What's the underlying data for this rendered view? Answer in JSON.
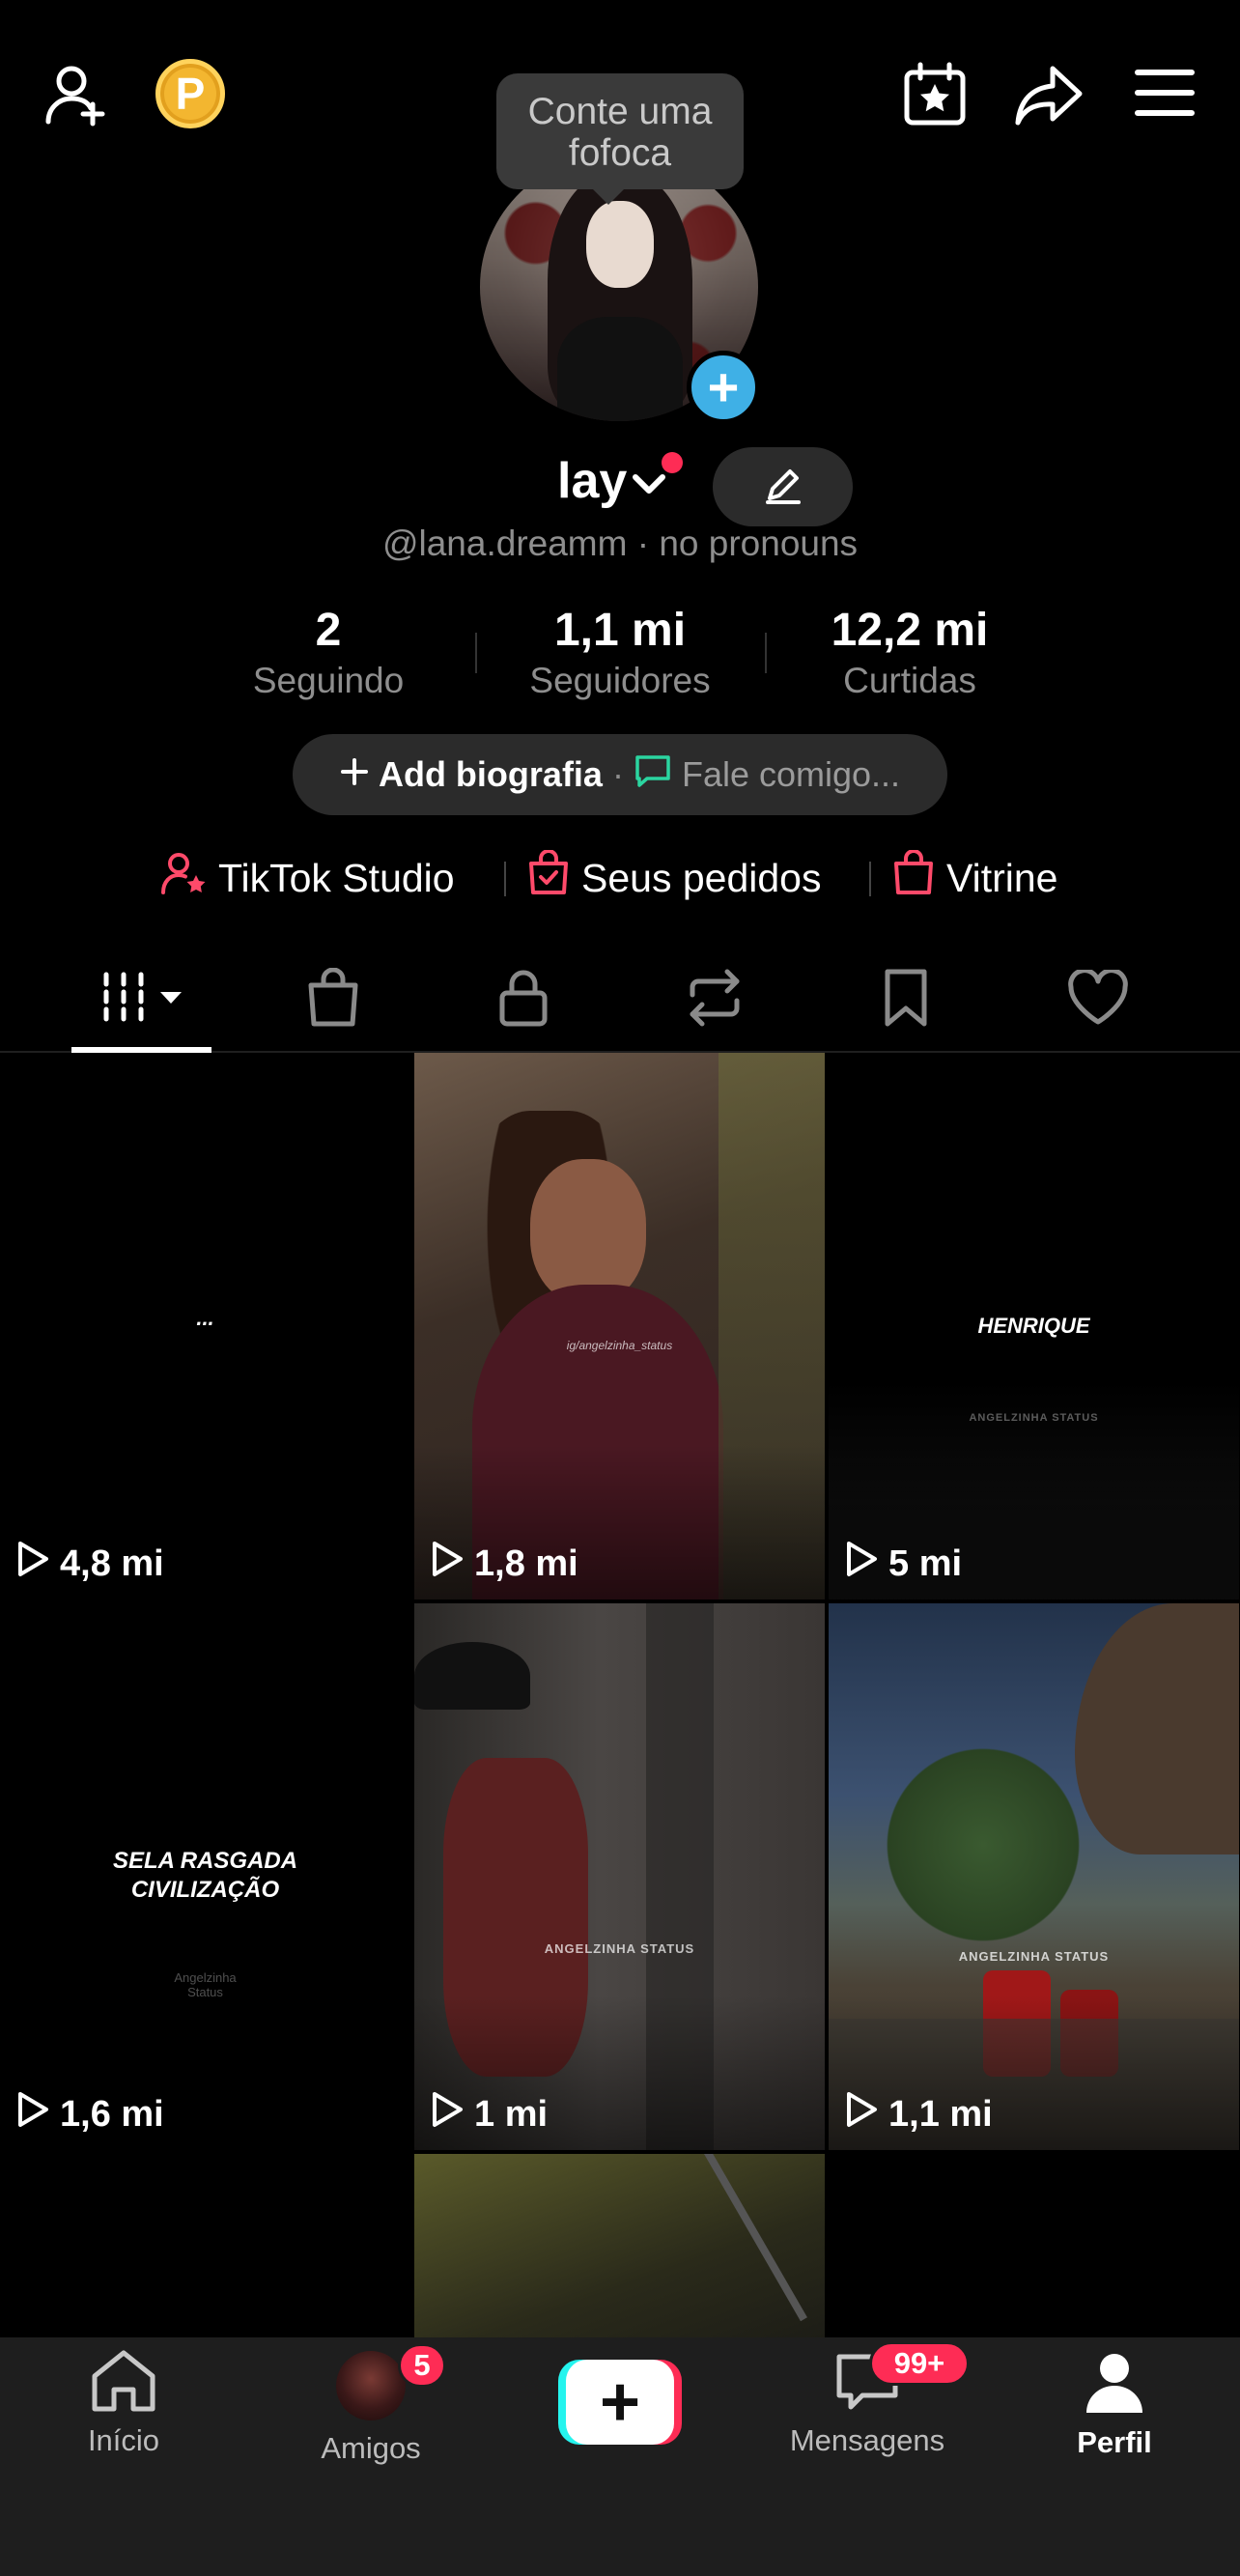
{
  "tooltip": "Conte uma fofoca",
  "profile": {
    "display_name": "lay",
    "handle": "@lana.dreamm · no pronouns"
  },
  "stats": [
    {
      "value": "2",
      "label": "Seguindo"
    },
    {
      "value": "1,1 mi",
      "label": "Seguidores"
    },
    {
      "value": "12,2 mi",
      "label": "Curtidas"
    }
  ],
  "bio": {
    "add_label": "Add biografia",
    "separator": "·",
    "chat_label": "Fale comigo..."
  },
  "links": [
    {
      "label": "TikTok Studio",
      "icon": "creator-icon"
    },
    {
      "label": "Seus pedidos",
      "icon": "orders-bag-icon"
    },
    {
      "label": "Vitrine",
      "icon": "shop-bag-icon"
    }
  ],
  "tabs": [
    "videos-grid-icon",
    "shop-bag-icon",
    "lock-icon",
    "repost-icon",
    "bookmark-icon",
    "heart-icon"
  ],
  "videos": [
    {
      "views": "4,8 mi",
      "text": "...",
      "bg": "#000000"
    },
    {
      "views": "1,8 mi",
      "text": "ig/angelzinha_status",
      "bg": "#4a3a32"
    },
    {
      "views": "5 mi",
      "text": "HENRIQUE",
      "bg": "#000000"
    },
    {
      "views": "1,6 mi",
      "text": "SELA RASGADA CIVILIZAÇÃO",
      "bg": "#000000"
    },
    {
      "views": "1 mi",
      "text": "ANGELZINHA STATUS",
      "bg": "#3a3634"
    },
    {
      "views": "1,1 mi",
      "text": "ANGELZINHA STATUS",
      "bg": "#2b3d57"
    }
  ],
  "watermarks": {
    "angelzinha": "ANGELZINHA STATUS",
    "angelzinha_script": "Angelzinha Status"
  },
  "nav": {
    "home": "Início",
    "friends": "Amigos",
    "friends_badge": "5",
    "messages": "Mensagens",
    "messages_badge": "99+",
    "profile": "Perfil"
  },
  "colors": {
    "accent_red": "#fe2c55",
    "accent_cyan": "#25f4ee",
    "coin": "#f3b630",
    "avatar_add": "#3fb0e6"
  }
}
